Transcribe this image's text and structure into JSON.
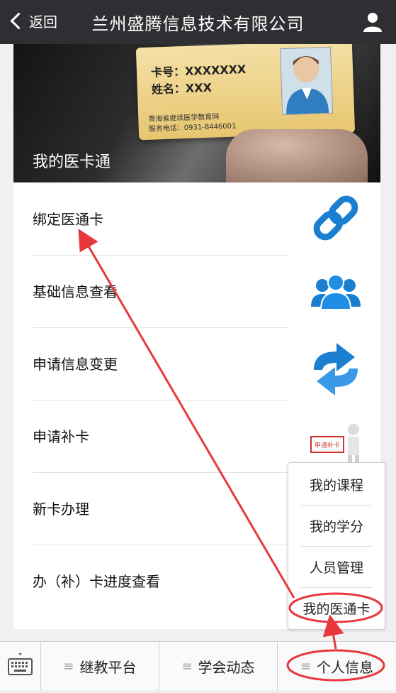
{
  "header": {
    "back_label": "返回",
    "title": "兰州盛腾信息技术有限公司",
    "user_icon": "user-icon"
  },
  "banner": {
    "title": "我的医卡通",
    "card_no_label": "卡号：XXXXXXX",
    "card_name_label": "姓名：XXX",
    "card_org": "青海省继续医学教育网",
    "card_phone": "服务电话：0931-8446001"
  },
  "menu": [
    {
      "label": "绑定医通卡",
      "icon": "link-icon"
    },
    {
      "label": "基础信息查看",
      "icon": "people-icon"
    },
    {
      "label": "申请信息变更",
      "icon": "swap-arrows-icon"
    },
    {
      "label": "申请补卡",
      "icon": "apply-card-icon"
    },
    {
      "label": "新卡办理",
      "icon": ""
    },
    {
      "label": "办（补）卡进度查看",
      "icon": ""
    }
  ],
  "apply_icon_text": "申请补卡",
  "popup": {
    "items": [
      "我的课程",
      "我的学分",
      "人员管理",
      "我的医通卡"
    ]
  },
  "tabbar": {
    "keyboard_icon": "keyboard-icon",
    "tabs": [
      "继教平台",
      "学会动态",
      "个人信息"
    ],
    "menu_glyph": "≡"
  },
  "colors": {
    "topbar": "#2f2f33",
    "accent_blue": "#1a7fd0",
    "annotation_red": "#e8383d"
  }
}
